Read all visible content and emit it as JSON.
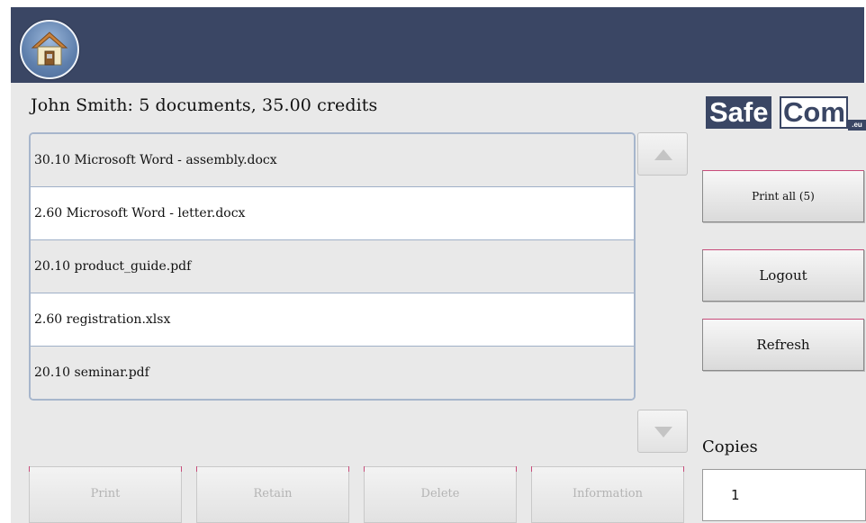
{
  "header": {
    "home_icon": "home-icon"
  },
  "summary": {
    "text": "John Smith: 5 documents, 35.00 credits"
  },
  "logo": {
    "part1": "Safe",
    "part2": "Com",
    "suffix": ".eu"
  },
  "documents": [
    {
      "label": "30.10 Microsoft Word - assembly.docx"
    },
    {
      "label": "2.60 Microsoft Word - letter.docx"
    },
    {
      "label": "20.10 product_guide.pdf"
    },
    {
      "label": "2.60 registration.xlsx"
    },
    {
      "label": "20.10 seminar.pdf"
    }
  ],
  "sidebar": {
    "print_all": "Print all (5)",
    "logout": "Logout",
    "refresh": "Refresh",
    "copies_label": "Copies",
    "copies_value": "1"
  },
  "actions": {
    "print": "Print",
    "retain": "Retain",
    "delete": "Delete",
    "information": "Information"
  },
  "colors": {
    "header_bg": "#3a4664",
    "panel_bg": "#e9e9e9",
    "row_border": "#9fb0c8",
    "disabled_text": "#b4b4b4"
  }
}
